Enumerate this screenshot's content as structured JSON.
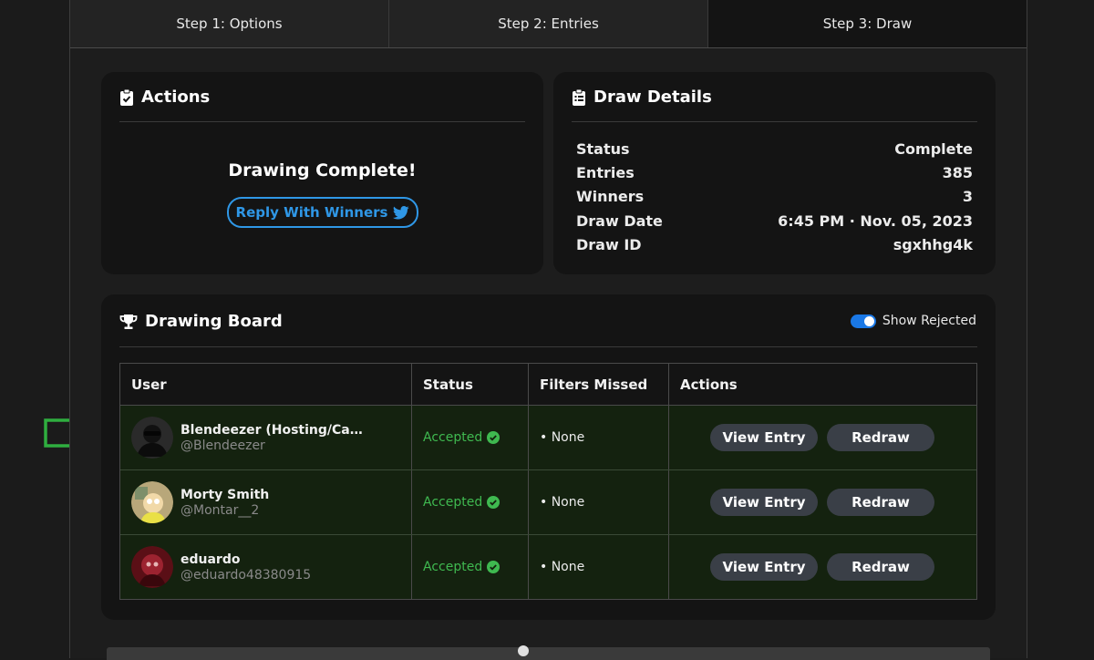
{
  "tabs": [
    {
      "label": "Step 1: Options",
      "active": false
    },
    {
      "label": "Step 2: Entries",
      "active": false
    },
    {
      "label": "Step 3: Draw",
      "active": true
    }
  ],
  "actions": {
    "title": "Actions",
    "message": "Drawing Complete!",
    "reply_label": "Reply With Winners"
  },
  "details": {
    "title": "Draw Details",
    "rows": [
      {
        "label": "Status",
        "value": "Complete"
      },
      {
        "label": "Entries",
        "value": "385"
      },
      {
        "label": "Winners",
        "value": "3"
      },
      {
        "label": "Draw Date",
        "value": "6:45 PM · Nov. 05, 2023"
      },
      {
        "label": "Draw ID",
        "value": "sgxhhg4k"
      }
    ]
  },
  "board": {
    "title": "Drawing Board",
    "toggle_label": "Show Rejected",
    "toggle_on": true,
    "columns": [
      "User",
      "Status",
      "Filters Missed",
      "Actions"
    ],
    "rows": [
      {
        "name": "Blendeezer (Hosting/Ca…",
        "handle": "@Blendeezer",
        "status": "Accepted",
        "filters": "• None",
        "view_label": "View Entry",
        "redraw_label": "Redraw"
      },
      {
        "name": "Morty Smith",
        "handle": "@Montar__2",
        "status": "Accepted",
        "filters": "• None",
        "view_label": "View Entry",
        "redraw_label": "Redraw"
      },
      {
        "name": "eduardo",
        "handle": "@eduardo48380915",
        "status": "Accepted",
        "filters": "• None",
        "view_label": "View Entry",
        "redraw_label": "Redraw"
      }
    ]
  },
  "colors": {
    "accent": "#2f97e6",
    "accepted": "#3fb950",
    "arrow": "#2fae3f"
  }
}
